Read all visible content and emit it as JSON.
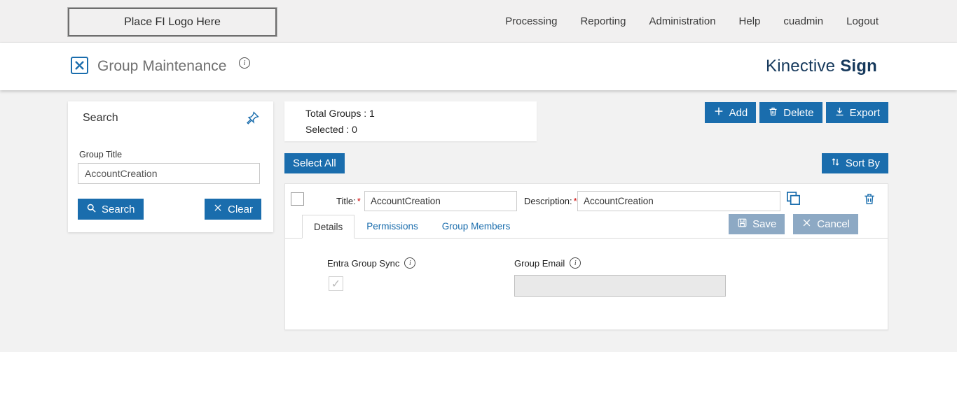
{
  "topbar": {
    "logo_placeholder": "Place FI Logo Here",
    "nav": [
      "Processing",
      "Reporting",
      "Administration",
      "Help",
      "cuadmin",
      "Logout"
    ]
  },
  "header": {
    "title": "Group Maintenance",
    "brand_name": "Kinective",
    "brand_bold": "Sign"
  },
  "search_panel": {
    "title": "Search",
    "group_title_label": "Group Title",
    "group_title_value": "AccountCreation",
    "search_button": "Search",
    "clear_button": "Clear"
  },
  "summary": {
    "total_groups": "Total Groups : 1",
    "selected": "Selected : 0"
  },
  "toolbar": {
    "add": "Add",
    "delete": "Delete",
    "export": "Export",
    "select_all": "Select All",
    "sort_by": "Sort By"
  },
  "group_row": {
    "title_label": "Title:",
    "required_marker": "*",
    "title_value": "AccountCreation",
    "description_label": "Description:",
    "description_value": "AccountCreation",
    "tabs": [
      {
        "label": "Details",
        "active": true
      },
      {
        "label": "Permissions",
        "active": false
      },
      {
        "label": "Group Members",
        "active": false
      }
    ],
    "save_button": "Save",
    "cancel_button": "Cancel",
    "details_tab": {
      "entra_group_sync_label": "Entra Group Sync",
      "entra_group_sync_checked": true,
      "group_email_label": "Group Email",
      "group_email_value": ""
    }
  },
  "colors": {
    "accent_blue": "#1A6DAD",
    "muted_steel_blue": "#8DA9C4",
    "brand_navy": "#16395C",
    "page_gray": "#F2F2F2",
    "required_red": "#CC0000"
  }
}
